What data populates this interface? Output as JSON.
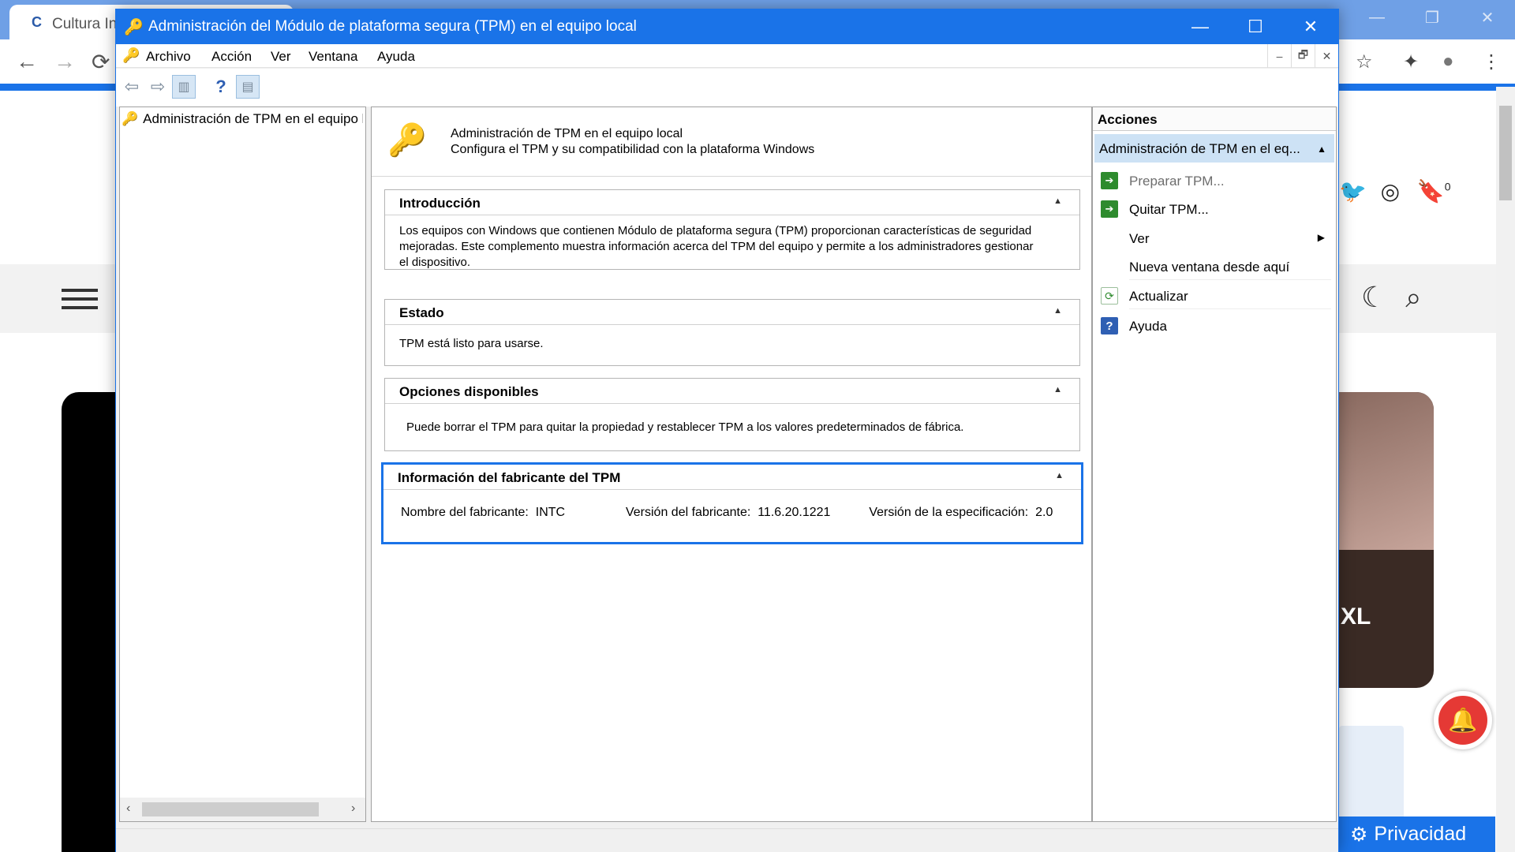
{
  "browser": {
    "tab_title": "Cultura In",
    "tab_favicon": "C",
    "window_controls": [
      "—",
      "❐",
      "✕"
    ],
    "toolbar": {
      "back": "←",
      "forward": "→",
      "reload": "⟳",
      "star": "☆",
      "ext": "✦",
      "profile": "●",
      "menu": "⋮"
    },
    "page": {
      "card_text": "XL",
      "privacy_label": "Privacidad",
      "bookmark_count": "0"
    }
  },
  "mmc": {
    "title": "Administración del Módulo de plataforma segura (TPM) en el equipo local",
    "controls": {
      "minimize": "—",
      "maximize": "☐",
      "close": "✕"
    },
    "menu": [
      "Archivo",
      "Acción",
      "Ver",
      "Ventana",
      "Ayuda"
    ],
    "inner_controls": [
      "–",
      "🗗",
      "✕"
    ],
    "tree": {
      "item": "Administración de TPM en el equipo local",
      "scroll_left": "‹",
      "scroll_right": "›"
    },
    "header": {
      "line1": "Administración de TPM en el equipo local",
      "line2": "Configura el TPM y su compatibilidad con la plataforma Windows"
    },
    "sections": {
      "intro": {
        "title": "Introducción",
        "body": "Los equipos con Windows que contienen Módulo de plataforma segura (TPM) proporcionan características de seguridad mejoradas. Este complemento muestra información acerca del TPM del equipo y permite a los administradores gestionar el dispositivo."
      },
      "status": {
        "title": "Estado",
        "body": "TPM está listo para usarse."
      },
      "options": {
        "title": "Opciones disponibles",
        "body": "Puede borrar el TPM para quitar la propiedad y restablecer TPM a los valores predeterminados de fábrica."
      },
      "manufacturer": {
        "title": "Información del fabricante del TPM",
        "name_label": "Nombre del fabricante:",
        "name_value": "INTC",
        "version_label": "Versión del fabricante:",
        "version_value": "11.6.20.1221",
        "spec_label": "Versión de la especificación:",
        "spec_value": "2.0"
      }
    },
    "actions": {
      "header": "Acciones",
      "group": "Administración de TPM en el eq...",
      "items": [
        {
          "label": "Preparar TPM...",
          "enabled": false
        },
        {
          "label": "Quitar TPM...",
          "enabled": true
        },
        {
          "label": "Ver",
          "enabled": true
        },
        {
          "label": "Nueva ventana desde aquí",
          "enabled": true
        },
        {
          "label": "Actualizar",
          "enabled": true
        },
        {
          "label": "Ayuda",
          "enabled": true
        }
      ]
    }
  },
  "colors": {
    "accent": "#1a73e8",
    "action_selected": "#cde2f5",
    "action_green": "#2e8b2e",
    "help_blue": "#2f5fb3"
  }
}
